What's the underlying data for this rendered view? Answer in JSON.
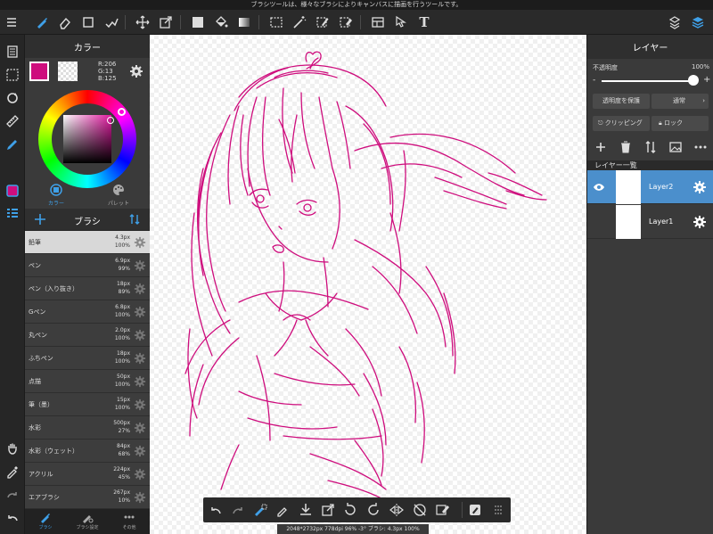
{
  "status_bar": {
    "text": "ブラシツールは、様々なブラシによりキャンバスに描画を行うツールです。"
  },
  "toolbar": {
    "icons": [
      "menu-icon",
      "brush-icon",
      "eraser-icon",
      "shape-icon",
      "smudge-icon",
      "move-icon",
      "transform-icon",
      "fill-color-icon",
      "bucket-icon",
      "gradient-icon",
      "select-icon",
      "magic-wand-icon",
      "select-pen-icon",
      "select-eraser-icon",
      "frame-icon",
      "operation-icon",
      "text-icon",
      "material-icon",
      "layers-icon"
    ],
    "text_icon_label": "T"
  },
  "color_panel": {
    "title": "カラー",
    "main_color": "#ce0d7d",
    "r": "R:206",
    "g": "G:13",
    "b": "B:125",
    "tab_color": "カラー",
    "tab_palette": "パレット"
  },
  "brush_panel": {
    "title": "ブラシ",
    "brushes": [
      {
        "name": "鉛筆",
        "size": "4.3px",
        "opacity": "100%"
      },
      {
        "name": "ペン",
        "size": "6.9px",
        "opacity": "99%"
      },
      {
        "name": "ペン（入り抜き）",
        "size": "18px",
        "opacity": "89%"
      },
      {
        "name": "Gペン",
        "size": "6.8px",
        "opacity": "100%"
      },
      {
        "name": "丸ペン",
        "size": "2.0px",
        "opacity": "100%"
      },
      {
        "name": "ふちペン",
        "size": "18px",
        "opacity": "100%"
      },
      {
        "name": "点描",
        "size": "50px",
        "opacity": "100%"
      },
      {
        "name": "筆（墨）",
        "size": "15px",
        "opacity": "100%"
      },
      {
        "name": "水彩",
        "size": "500px",
        "opacity": "27%"
      },
      {
        "name": "水彩（ウェット）",
        "size": "84px",
        "opacity": "68%"
      },
      {
        "name": "アクリル",
        "size": "224px",
        "opacity": "45%"
      },
      {
        "name": "エアブラシ",
        "size": "267px",
        "opacity": "10%"
      }
    ],
    "tabs": [
      "ブラシ",
      "ブラシ設定",
      "その他"
    ]
  },
  "info_bar": {
    "text": "2048*2732px 778dpi 96% -3° ブラシ: 4.3px 100%"
  },
  "layer_panel": {
    "title": "レイヤー",
    "opacity_label": "不透明度",
    "opacity_value": "100%",
    "opacity_fraction": 1.0,
    "protect_alpha": "透明度を保護",
    "blend_mode": "通常",
    "clipping": "クリッピング",
    "lock": "ロック",
    "list_header": "レイヤー一覧",
    "layers": [
      {
        "name": "Layer2",
        "selected": true
      },
      {
        "name": "Layer1",
        "selected": false
      }
    ]
  },
  "colors": {
    "accent": "#4b8fcc",
    "stroke": "#ce0d7d"
  }
}
